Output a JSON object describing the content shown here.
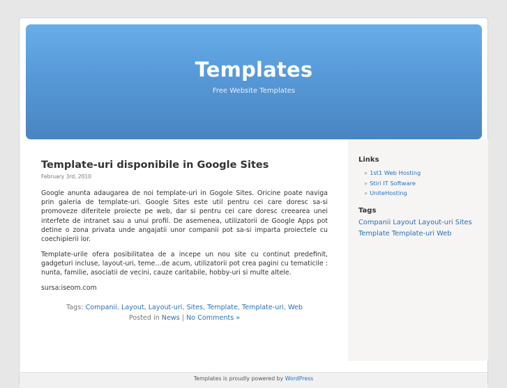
{
  "blog": {
    "title": "Templates",
    "description": "Free Website Templates"
  },
  "post": {
    "title": "Template-uri disponibile in Google Sites",
    "date": "February 3rd, 2010",
    "paragraphs": [
      "Google anunta adaugarea de noi template-uri in Gogole Sites. Oricine poate naviga prin galeria de template-uri. Google Sites este util pentru cei care doresc sa-si promoveze diferitele proiecte pe web, dar si pentru cei care doresc creearea unei interfete de intranet sau a unui profil. De asemenea, utilizatorii de Google Apps pot detine o zona privata unde angajatii unor companii pot sa-si imparta proiectele cu coechipierii lor.",
      "Template-urile ofera posibilitatea de a incepe un nou site cu continut predefinit, gadgeturi incluse, layout-uri, teme…de acum, utilizatorii pot crea pagini cu tematicile : nunta, familie, asociatii de vecini, cauze caritabile, hobby-uri si multe altele.",
      "sursa:iseom.com"
    ],
    "tags_label": "Tags:",
    "tags": [
      "Companii",
      "Layout",
      "Layout-uri",
      "Sites",
      "Template",
      "Template-uri",
      "Web"
    ],
    "posted_in_label": "Posted in",
    "category": "News",
    "separator": "|",
    "comments_link": "No Comments »"
  },
  "sidebar": {
    "links_title": "Links",
    "links": [
      "1st1 Web Hosting",
      "Stiri IT Software",
      "UniteHosting"
    ],
    "link_arrow": "»",
    "tags_title": "Tags",
    "tag_cloud": [
      "Companii",
      "Layout",
      "Layout-uri",
      "Sites",
      "Template",
      "Template-uri",
      "Web"
    ]
  },
  "footer": {
    "text": "Templates is proudly powered by",
    "link": "WordPress"
  },
  "colors": {
    "link": "#2970b8",
    "header_top": "#68adea",
    "header_bottom": "#4a84c2"
  }
}
